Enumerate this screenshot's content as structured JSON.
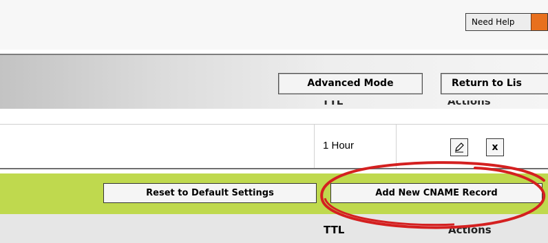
{
  "header": {
    "help_label": "Need Help"
  },
  "toolbar": {
    "advanced_mode_label": "Advanced Mode",
    "return_label": "Return to Lis"
  },
  "table_top": {
    "ttl_header": "TTL",
    "actions_header": "Actions"
  },
  "record_row": {
    "ttl": "1 Hour",
    "delete_label": "x"
  },
  "action_bar": {
    "reset_label": "Reset to Default Settings",
    "add_label": "Add New CNAME Record"
  },
  "table_bottom": {
    "ttl_header": "TTL",
    "actions_header": "Actions"
  },
  "colors": {
    "green_bar": "#bfd94e",
    "help_icon": "#e8701e",
    "annotation": "#d42020"
  }
}
